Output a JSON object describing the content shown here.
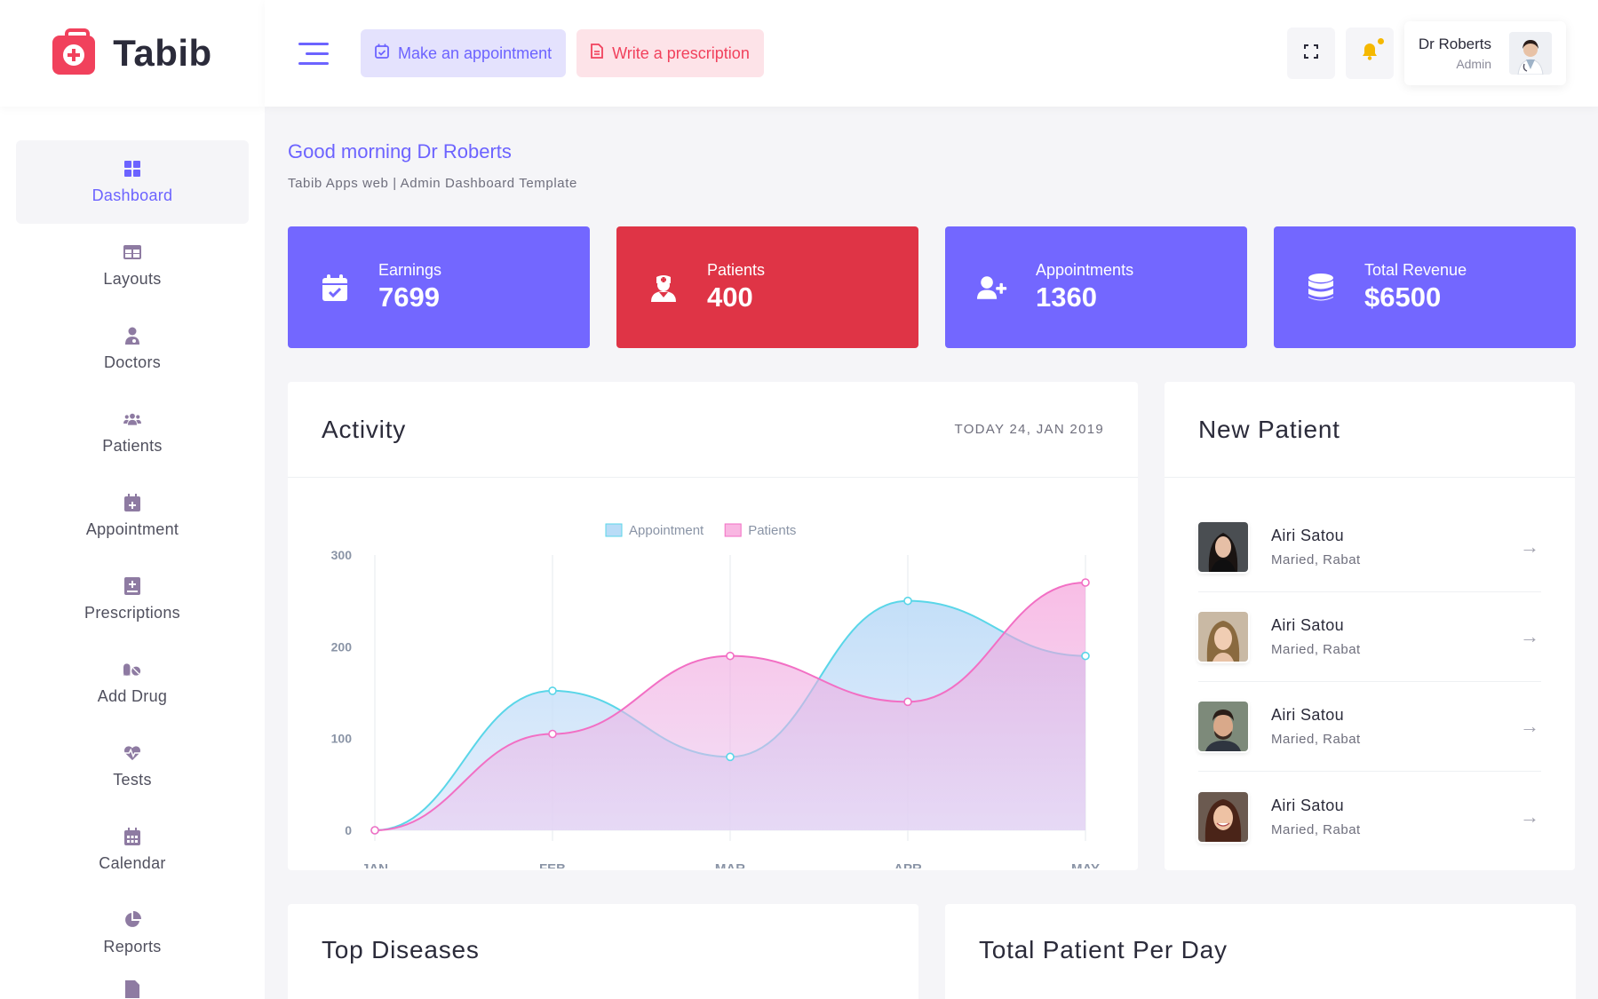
{
  "brand": {
    "name": "Tabib"
  },
  "sidebar": {
    "items": [
      {
        "label": "Dashboard",
        "icon": "dashboard-icon",
        "active": true
      },
      {
        "label": "Layouts",
        "icon": "layout-icon"
      },
      {
        "label": "Doctors",
        "icon": "doctor-icon"
      },
      {
        "label": "Patients",
        "icon": "users-icon"
      },
      {
        "label": "Appointment",
        "icon": "calendar-plus-icon"
      },
      {
        "label": "Prescriptions",
        "icon": "prescription-book-icon"
      },
      {
        "label": "Add Drug",
        "icon": "pills-icon"
      },
      {
        "label": "Tests",
        "icon": "heartbeat-icon"
      },
      {
        "label": "Calendar",
        "icon": "calendar-icon"
      },
      {
        "label": "Reports",
        "icon": "pie-chart-icon"
      }
    ]
  },
  "header": {
    "appointment_btn": "Make an appointment",
    "prescription_btn": "Write a prescription",
    "user": {
      "name": "Dr Roberts",
      "role": "Admin"
    }
  },
  "greeting": {
    "title": "Good morning Dr Roberts",
    "subtitle": "Tabib Apps web | Admin Dashboard Template"
  },
  "stats": [
    {
      "label": "Earnings",
      "value": "7699",
      "color": "#7367ff",
      "icon": "calendar-check-icon"
    },
    {
      "label": "Patients",
      "value": "400",
      "color": "#df3446",
      "icon": "nurse-icon"
    },
    {
      "label": "Appointments",
      "value": "1360",
      "color": "#7367ff",
      "icon": "user-plus-icon"
    },
    {
      "label": "Total Revenue",
      "value": "$6500",
      "color": "#7367ff",
      "icon": "database-icon"
    }
  ],
  "activity": {
    "title": "Activity",
    "date": "TODAY 24, JAN 2019"
  },
  "chart_data": {
    "type": "area",
    "categories": [
      "JAN",
      "FEB",
      "MAR",
      "APR",
      "MAY"
    ],
    "ylim": [
      0,
      300
    ],
    "yticks": [
      0,
      100,
      200,
      300
    ],
    "series": [
      {
        "name": "Appointment",
        "values": [
          0,
          152,
          80,
          250,
          190
        ],
        "color": "#5ad6e8"
      },
      {
        "name": "Patients",
        "values": [
          0,
          105,
          190,
          140,
          270
        ],
        "color": "#f26fc4"
      }
    ],
    "legend": "top-center"
  },
  "new_patient": {
    "title": "New Patient",
    "items": [
      {
        "name": "Airi Satou",
        "meta": "Maried, Rabat"
      },
      {
        "name": "Airi Satou",
        "meta": "Maried, Rabat"
      },
      {
        "name": "Airi Satou",
        "meta": "Maried, Rabat"
      },
      {
        "name": "Airi Satou",
        "meta": "Maried, Rabat"
      }
    ]
  },
  "bottom": {
    "top_diseases": "Top Diseases",
    "per_day": "Total Patient Per Day"
  }
}
